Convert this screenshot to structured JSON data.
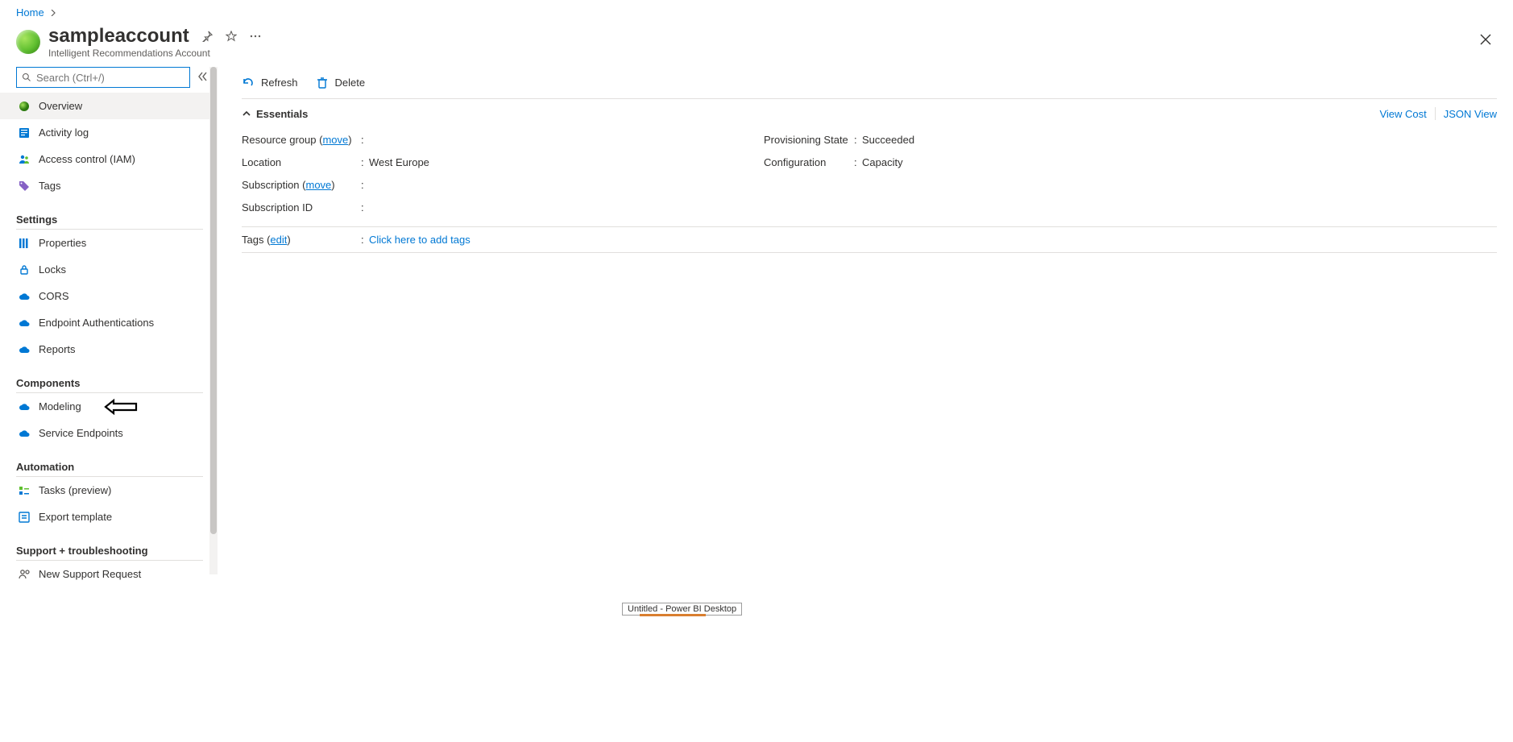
{
  "breadcrumb": {
    "home": "Home"
  },
  "header": {
    "title": "sampleaccount",
    "subtitle": "Intelligent Recommendations Account"
  },
  "search": {
    "placeholder": "Search (Ctrl+/)"
  },
  "sidebar": {
    "top": [
      {
        "label": "Overview"
      },
      {
        "label": "Activity log"
      },
      {
        "label": "Access control (IAM)"
      },
      {
        "label": "Tags"
      }
    ],
    "settings_label": "Settings",
    "settings": [
      {
        "label": "Properties"
      },
      {
        "label": "Locks"
      },
      {
        "label": "CORS"
      },
      {
        "label": "Endpoint Authentications"
      },
      {
        "label": "Reports"
      }
    ],
    "components_label": "Components",
    "components": [
      {
        "label": "Modeling"
      },
      {
        "label": "Service Endpoints"
      }
    ],
    "automation_label": "Automation",
    "automation": [
      {
        "label": "Tasks (preview)"
      },
      {
        "label": "Export template"
      }
    ],
    "support_label": "Support + troubleshooting",
    "support": [
      {
        "label": "New Support Request"
      }
    ]
  },
  "commands": {
    "refresh": "Refresh",
    "delete": "Delete"
  },
  "essentials": {
    "header": "Essentials",
    "view_cost": "View Cost",
    "json_view": "JSON View",
    "resource_group_label": "Resource group",
    "move1": "move",
    "location_label": "Location",
    "location_value": "West Europe",
    "subscription_label": "Subscription",
    "move2": "move",
    "subscription_id_label": "Subscription ID",
    "prov_label": "Provisioning State",
    "prov_value": "Succeeded",
    "config_label": "Configuration",
    "config_value": "Capacity",
    "tags_label": "Tags",
    "tags_edit": "edit",
    "tags_action": "Click here to add tags"
  },
  "taskbar_tip": "Untitled - Power BI Desktop"
}
